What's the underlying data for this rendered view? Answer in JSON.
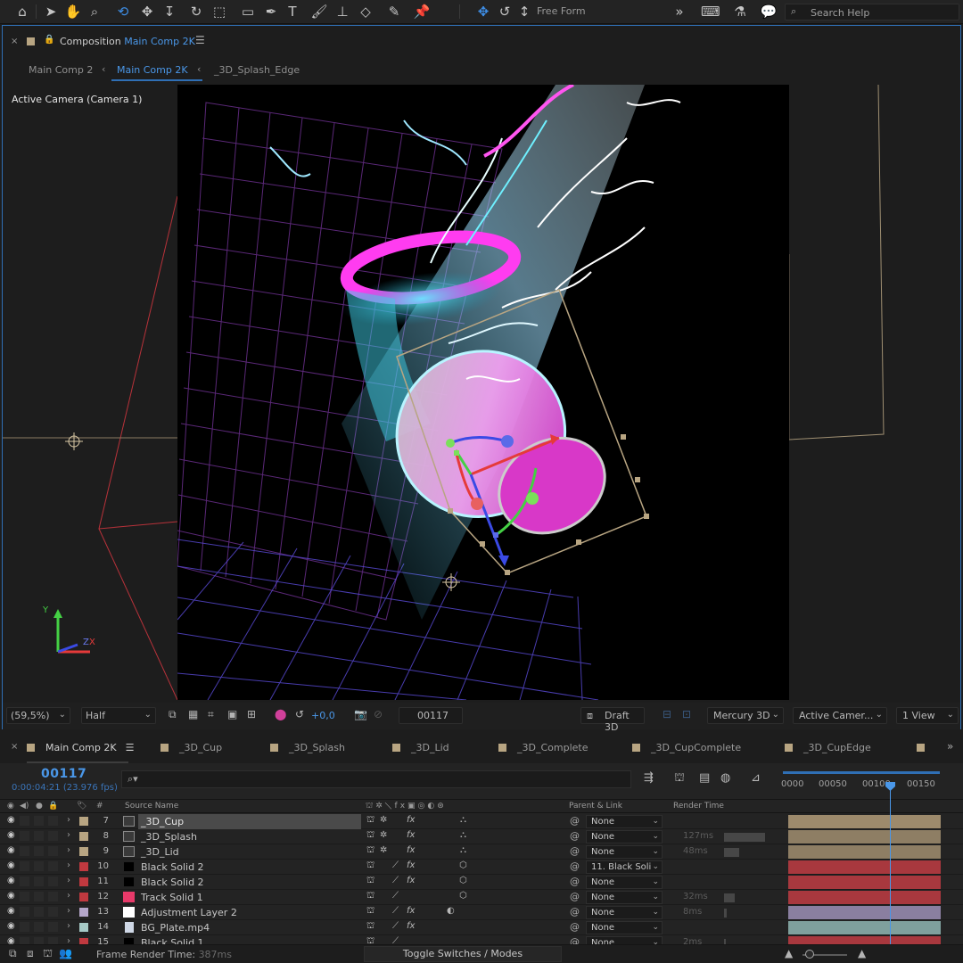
{
  "toolbar": {
    "freeform_label": "Free Form",
    "search_placeholder": "Search Help"
  },
  "comp_panel": {
    "title_prefix": "Composition",
    "title_name": "Main Comp 2K",
    "breadcrumbs": [
      "Main Comp 2",
      "Main Comp 2K",
      "_3D_Splash_Edge"
    ],
    "view_label": "Active Camera (Camera 1)",
    "footer": {
      "zoom": "(59,5%)",
      "resolution": "Half",
      "exposure": "+0,0",
      "frame": "00117",
      "draft": "Draft 3D",
      "renderer": "Mercury 3D",
      "camera": "Active Camer...",
      "views": "1 View"
    }
  },
  "timeline": {
    "tabs": [
      "Main Comp 2K",
      "_3D_Cup",
      "_3D_Splash",
      "_3D_Lid",
      "_3D_Complete",
      "_3D_CupComplete",
      "_3D_CupEdge"
    ],
    "timecode": "00117",
    "timecode_sub": "0:00:04:21 (23.976 fps)",
    "ruler": [
      "0000",
      "00050",
      "00100",
      "00150"
    ],
    "columns": {
      "hash": "#",
      "source_name": "Source Name",
      "parent_link": "Parent & Link",
      "render_time": "Render Time"
    },
    "layers": [
      {
        "num": "7",
        "name": "_3D_Cup",
        "parent": "None",
        "render_time": "",
        "label_color": "#b8a582",
        "bar_color": "#9d8a6c",
        "type": "comp",
        "selected": true
      },
      {
        "num": "8",
        "name": "_3D_Splash",
        "parent": "None",
        "render_time": "127ms",
        "label_color": "#b8a582",
        "bar_color": "#8e7e64",
        "type": "comp",
        "selected": false
      },
      {
        "num": "9",
        "name": "_3D_Lid",
        "parent": "None",
        "render_time": "48ms",
        "label_color": "#b8a582",
        "bar_color": "#8e7e64",
        "type": "comp",
        "selected": false
      },
      {
        "num": "10",
        "name": "Black Solid 2",
        "parent": "11. Black Soli",
        "render_time": "",
        "label_color": "#c0393f",
        "bar_color": "#a8383e",
        "type": "solid",
        "selected": false
      },
      {
        "num": "11",
        "name": "Black Solid 2",
        "parent": "None",
        "render_time": "",
        "label_color": "#c0393f",
        "bar_color": "#a8383e",
        "type": "solid",
        "selected": false
      },
      {
        "num": "12",
        "name": "Track Solid 1",
        "parent": "None",
        "render_time": "32ms",
        "label_color": "#c0393f",
        "bar_color": "#a8383e",
        "type": "pink",
        "selected": false
      },
      {
        "num": "13",
        "name": "Adjustment Layer 2",
        "parent": "None",
        "render_time": "8ms",
        "label_color": "#b4a6c9",
        "bar_color": "#8a7fa0",
        "type": "adj",
        "selected": false
      },
      {
        "num": "14",
        "name": "BG_Plate.mp4",
        "parent": "None",
        "render_time": "",
        "label_color": "#a6c9c6",
        "bar_color": "#7fa09d",
        "type": "file",
        "selected": false
      },
      {
        "num": "15",
        "name": "Black Solid 1",
        "parent": "None",
        "render_time": "2ms",
        "label_color": "#c0393f",
        "bar_color": "#a8383e",
        "type": "solid",
        "selected": false
      }
    ],
    "frame_render_label": "Frame Render Time:",
    "frame_render_value": "387ms",
    "toggle_label": "Toggle Switches / Modes"
  }
}
